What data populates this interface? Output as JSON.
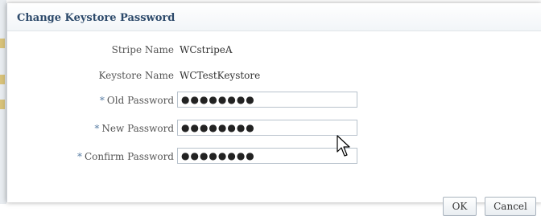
{
  "dialog": {
    "title": "Change Keystore Password"
  },
  "fields": {
    "stripe_name": {
      "label": "Stripe Name",
      "value": "WCstripeA"
    },
    "keystore_name": {
      "label": "Keystore Name",
      "value": "WCTestKeystore"
    },
    "old_password": {
      "required_mark": "*",
      "label": "Old Password",
      "value": "●●●●●●●●"
    },
    "new_password": {
      "required_mark": "*",
      "label": "New Password",
      "value": "●●●●●●●●"
    },
    "confirm_password": {
      "required_mark": "*",
      "label": "Confirm Password",
      "value": "●●●●●●●●"
    }
  },
  "buttons": {
    "ok": "OK",
    "cancel": "Cancel"
  },
  "icons": {
    "pointer": "mouse-pointer-icon"
  },
  "colors": {
    "title": "#2d4a6b",
    "required": "#5b7fa5"
  }
}
